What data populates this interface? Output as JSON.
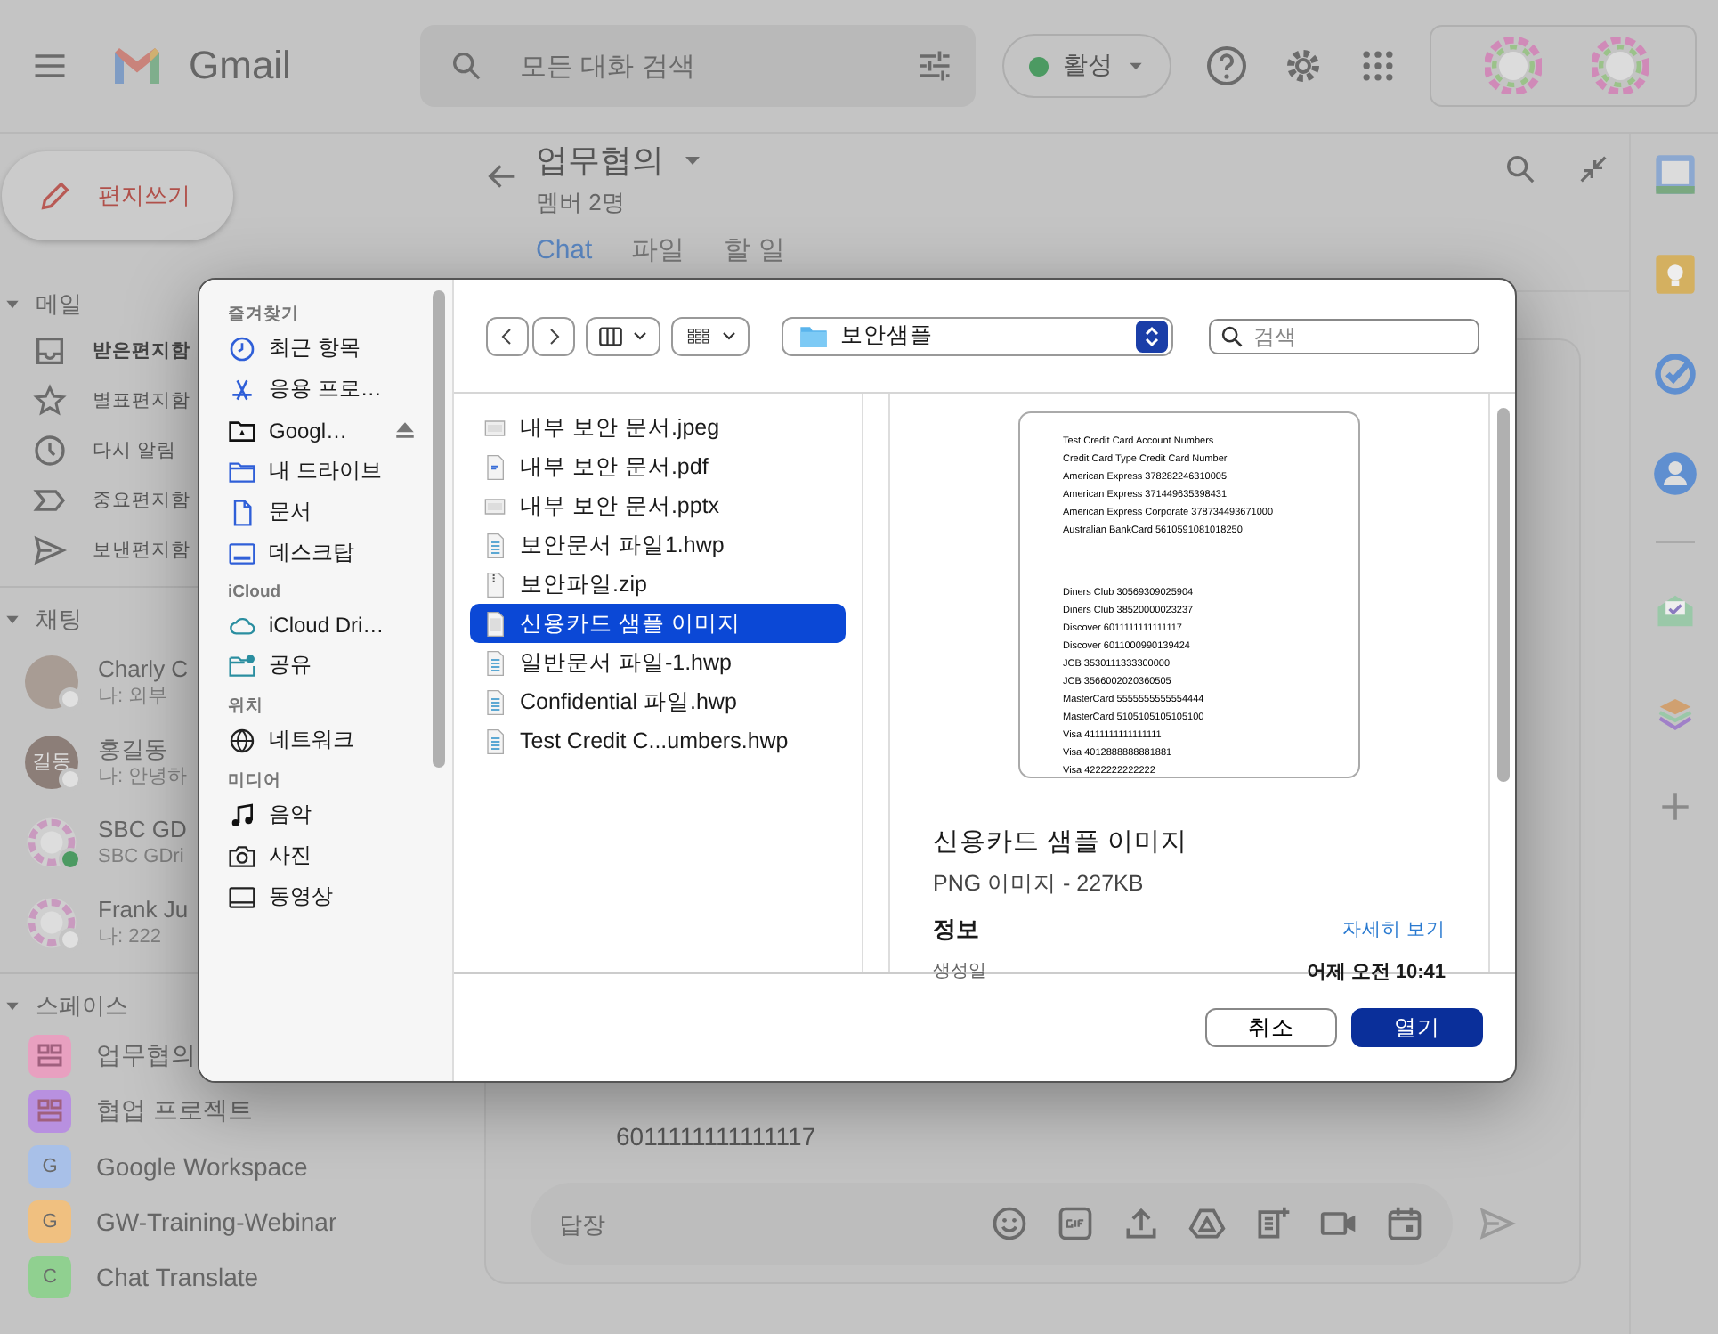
{
  "topbar": {
    "product": "Gmail",
    "search": {
      "placeholder": "모든 대화 검색"
    },
    "status": {
      "label": "활성"
    }
  },
  "sidebar": {
    "compose": "편지쓰기",
    "mail": {
      "title": "메일",
      "expanded": true,
      "items": [
        {
          "label": "받은편지함",
          "unread": true
        },
        {
          "label": "별표편지함",
          "unread": false
        },
        {
          "label": "다시 알림",
          "unread": false
        },
        {
          "label": "중요편지함",
          "unread": false
        },
        {
          "label": "보낸편지함",
          "unread": false
        }
      ]
    },
    "chats": {
      "title": "채팅",
      "expanded": true,
      "items": [
        {
          "name": "Charly C",
          "preview": "나: 외부",
          "kind": "photo",
          "online": false
        },
        {
          "name": "홍길동",
          "preview": "나: 안녕하",
          "kind": "initials",
          "initials": "길동",
          "online": false
        },
        {
          "name": "SBC GD",
          "preview": "SBC GDri",
          "kind": "logo",
          "online": true
        },
        {
          "name": "Frank Ju",
          "preview": "나: 222",
          "kind": "logo",
          "online": false
        }
      ]
    },
    "spaces": {
      "title": "스페이스",
      "expanded": true,
      "items": [
        {
          "label": "업무협의",
          "kind": "grid",
          "color": "#e8a0c0"
        },
        {
          "label": "협업 프로젝트",
          "kind": "grid",
          "color": "#b890e0"
        },
        {
          "label": "Google Workspace",
          "kind": "letter",
          "letter": "G",
          "color": "#a8c0e8"
        },
        {
          "label": "GW-Training-Webinar",
          "kind": "letter",
          "letter": "G",
          "color": "#f0c080"
        },
        {
          "label": "Chat Translate",
          "kind": "letter",
          "letter": "C",
          "color": "#90d090"
        }
      ]
    }
  },
  "chat": {
    "title": "업무협의",
    "subtitle": "멤버 2명",
    "tabs": [
      {
        "label": "Chat",
        "selected": true
      },
      {
        "label": "파일",
        "selected": false
      },
      {
        "label": "할 일",
        "selected": false
      }
    ],
    "message": "6011111111111117",
    "reply": {
      "placeholder": "답장"
    }
  },
  "dialog": {
    "sidebar": [
      {
        "title": "즐겨찾기",
        "items": [
          {
            "label": "최근 항목",
            "ejectable": false
          },
          {
            "label": "응용 프로…",
            "ejectable": false
          },
          {
            "label": "Googl…",
            "ejectable": true
          },
          {
            "label": "내 드라이브",
            "ejectable": false
          },
          {
            "label": "문서",
            "ejectable": false
          },
          {
            "label": "데스크탑",
            "ejectable": false
          }
        ]
      },
      {
        "title": "iCloud",
        "items": [
          {
            "label": "iCloud Dri…",
            "ejectable": false
          },
          {
            "label": "공유",
            "ejectable": false
          }
        ]
      },
      {
        "title": "위치",
        "items": [
          {
            "label": "네트워크",
            "ejectable": false
          }
        ]
      },
      {
        "title": "미디어",
        "items": [
          {
            "label": "음악",
            "ejectable": false
          },
          {
            "label": "사진",
            "ejectable": false
          },
          {
            "label": "동영상",
            "ejectable": false
          }
        ]
      }
    ],
    "location": "보안샘플",
    "search": {
      "placeholder": "검색"
    },
    "files": [
      {
        "name": "내부 보안 문서.jpeg",
        "kind": "image",
        "selected": false
      },
      {
        "name": "내부 보안 문서.pdf",
        "kind": "pdf",
        "selected": false
      },
      {
        "name": "내부 보안 문서.pptx",
        "kind": "image",
        "selected": false
      },
      {
        "name": "보안문서 파일1.hwp",
        "kind": "hwp",
        "selected": false
      },
      {
        "name": "보안파일.zip",
        "kind": "zip",
        "selected": false
      },
      {
        "name": "신용카드 샘플 이미지",
        "kind": "png",
        "selected": true
      },
      {
        "name": "일반문서 파일-1.hwp",
        "kind": "hwp",
        "selected": false
      },
      {
        "name": "Confidential 파일.hwp",
        "kind": "hwp",
        "selected": false
      },
      {
        "name": "Test Credit C...umbers.hwp",
        "kind": "hwp",
        "selected": false
      }
    ],
    "preview": {
      "document": [
        [
          "Test Credit Card Account Numbers",
          "Credit Card Type Credit Card Number",
          "American Express 378282246310005",
          "American Express 371449635398431",
          "American Express Corporate 378734493671000",
          "Australian BankCard 5610591081018250"
        ],
        [
          "Diners Club 30569309025904",
          "Diners Club 38520000023237",
          "Discover 6011111111111117",
          "Discover 6011000990139424",
          "JCB 3530111333300000",
          "JCB 3566002020360505",
          "MasterCard 5555555555554444",
          "MasterCard 5105105105105100",
          "Visa 4111111111111111",
          "Visa 4012888888881881",
          "Visa 4222222222222"
        ]
      ],
      "name": "신용카드 샘플 이미지",
      "info": "PNG 이미지 - 227KB",
      "section": "정보",
      "more": "자세히 보기",
      "rows": [
        {
          "label": "생성일",
          "value": "어제 오전 10:41"
        }
      ]
    },
    "buttons": [
      {
        "label": "취소",
        "kind": "secondary"
      },
      {
        "label": "열기",
        "kind": "primary"
      }
    ]
  }
}
